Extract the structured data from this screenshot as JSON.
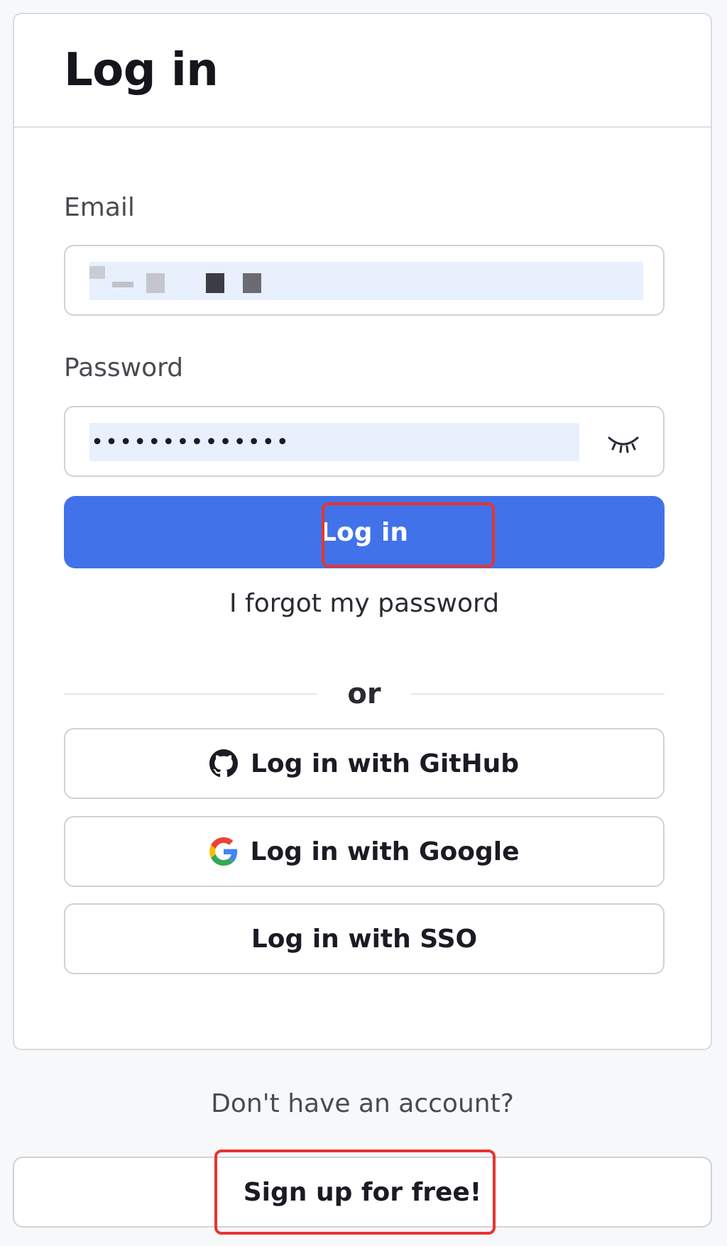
{
  "card": {
    "title": "Log in"
  },
  "form": {
    "email_label": "Email",
    "email_value": "",
    "password_label": "Password",
    "password_value": "••••••••••••••",
    "show_password_icon": "eye-closed-icon",
    "login_label": "Log in",
    "forgot_label": "I forgot my password",
    "or_label": "or"
  },
  "social": {
    "github_label": "Log in with GitHub",
    "github_icon": "github-icon",
    "google_label": "Log in with Google",
    "google_icon": "google-icon",
    "sso_label": "Log in with SSO"
  },
  "signup": {
    "prompt": "Don't have an account?",
    "label": "Sign up for free!"
  },
  "colors": {
    "primary": "#4172ea",
    "highlight": "#e8352e",
    "autofill": "#e8f0fe"
  }
}
